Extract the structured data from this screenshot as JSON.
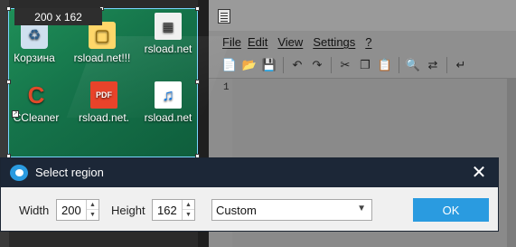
{
  "region_overlay": {
    "size_label": "200 x 162"
  },
  "desktop_icons": [
    {
      "label": "Корзина",
      "icon": "recycle-bin-icon"
    },
    {
      "label": "rsload.net!!!",
      "icon": "folder-icon"
    },
    {
      "label": "rsload.net",
      "icon": "grid-app-icon"
    },
    {
      "label": "CCleaner",
      "icon": "ccleaner-icon"
    },
    {
      "label": "rsload.net.",
      "icon": "pdf-icon"
    },
    {
      "label": "rsload.net",
      "icon": "music-file-icon"
    }
  ],
  "notepad": {
    "menu": [
      "File",
      "Edit",
      "View",
      "Settings",
      "?"
    ],
    "line_number": "1"
  },
  "dialog": {
    "title": "Select region",
    "width_label": "Width",
    "width_value": "200",
    "height_label": "Height",
    "height_value": "162",
    "preset_value": "Custom",
    "ok_label": "OK",
    "accent_color": "#2a9be0",
    "titlebar_color": "#1c2737"
  }
}
